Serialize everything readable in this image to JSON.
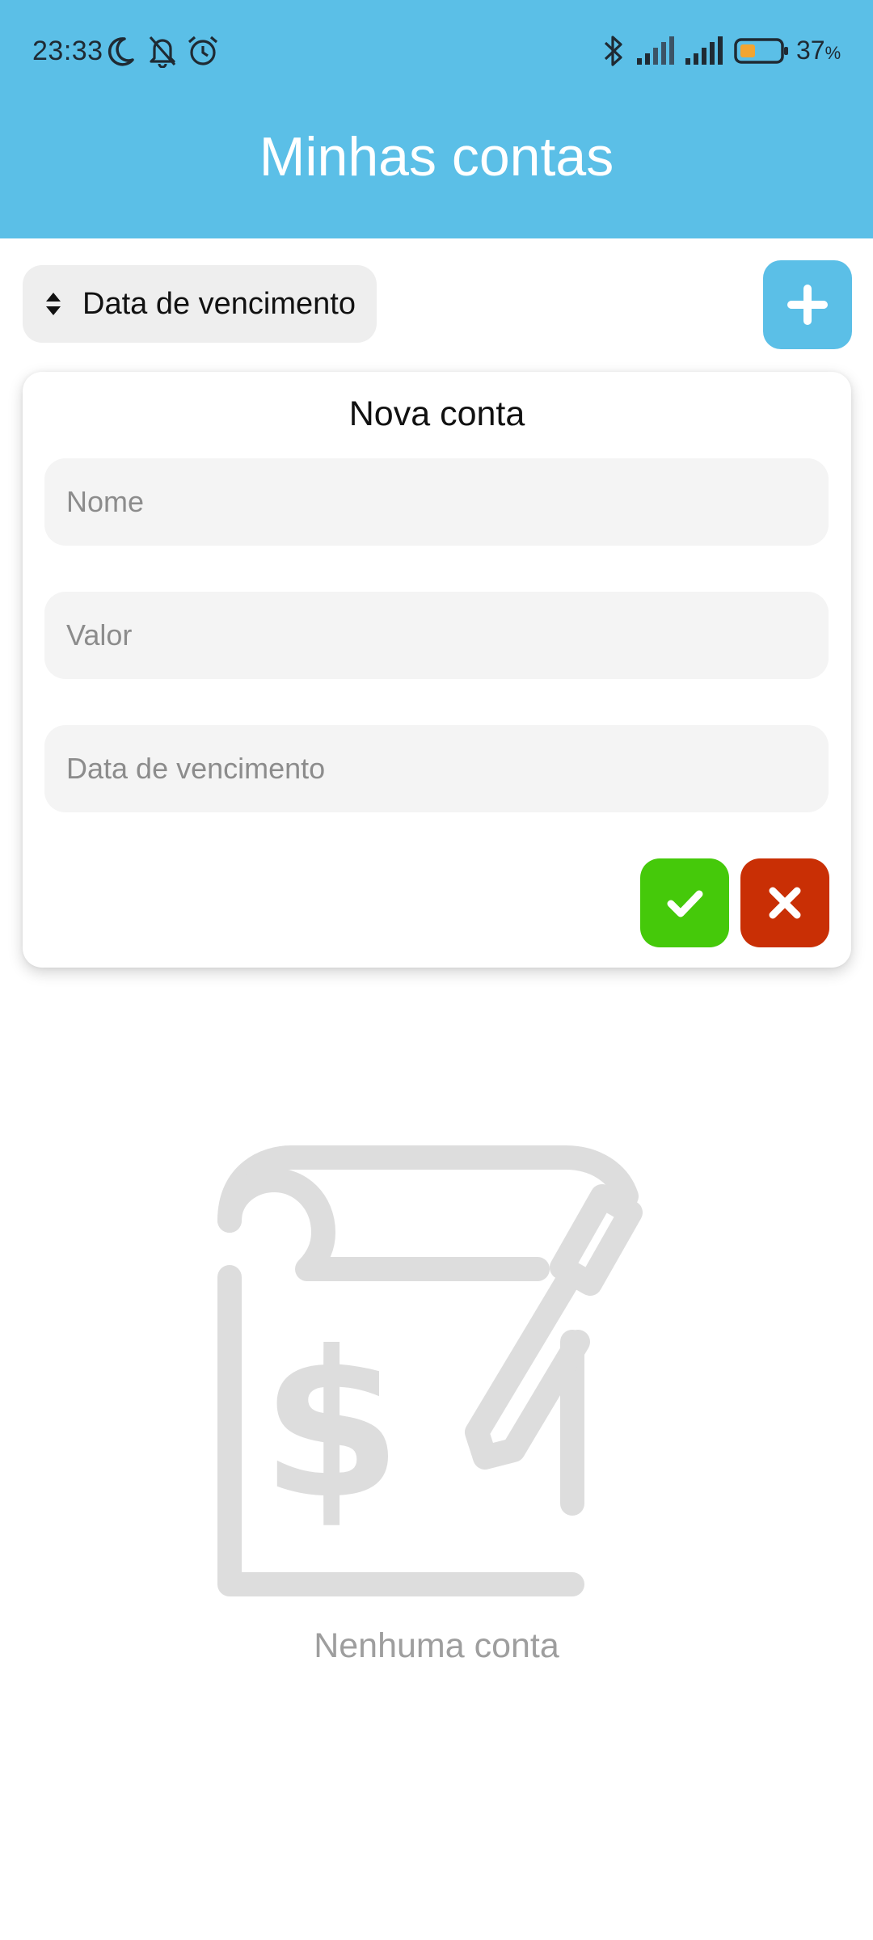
{
  "status_bar": {
    "time": "23:33",
    "battery_percent": "37",
    "battery_unit": "%",
    "icons": [
      "moon-icon",
      "bell-off-icon",
      "alarm-icon",
      "bluetooth-icon",
      "signal-icon",
      "signal-icon",
      "battery-icon"
    ]
  },
  "header": {
    "title": "Minhas contas"
  },
  "sort": {
    "label": "Data de vencimento",
    "icon": "sort-icon"
  },
  "add_button": {
    "icon": "plus-icon"
  },
  "new_account_form": {
    "title": "Nova conta",
    "name_placeholder": "Nome",
    "value_placeholder": "Valor",
    "due_date_placeholder": "Data de vencimento",
    "confirm_icon": "check-icon",
    "cancel_icon": "close-icon"
  },
  "empty_state": {
    "icon": "bill-icon",
    "text": "Nenhuma conta"
  },
  "colors": {
    "header": "#5bbfe7",
    "confirm": "#45c90a",
    "cancel": "#c92f05",
    "illustration": "#dddddd"
  }
}
